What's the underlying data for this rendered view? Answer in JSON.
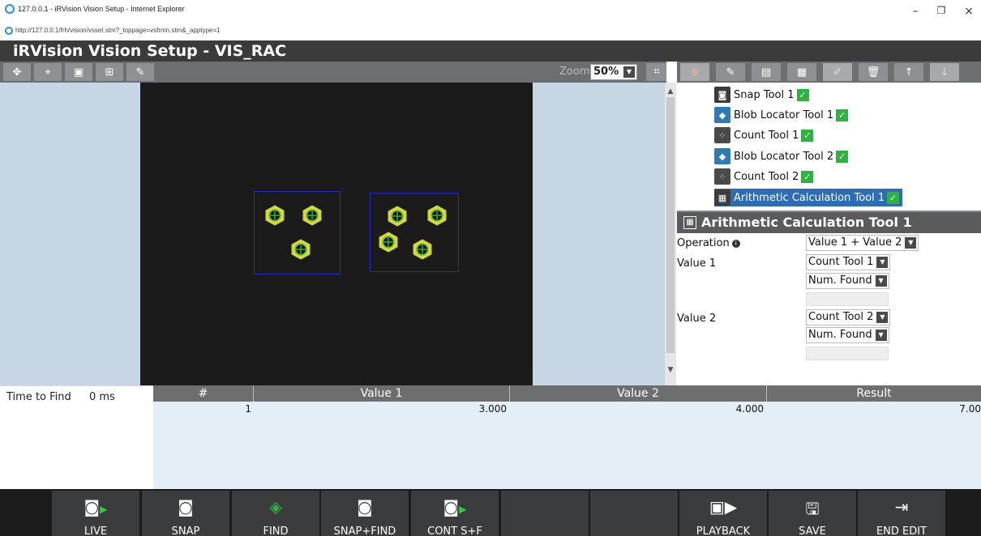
{
  "browser": {
    "window_title": "127.0.0.1 - iRVision Vision Setup - Internet Explorer",
    "url": "http://127.0.0.1/frh/vision/vsset.stm?_toppage=vsfrmn.stm&_apptype=1",
    "minimize": "–",
    "restore": "❐",
    "close": "×"
  },
  "app": {
    "title": "iRVision Vision Setup - VIS_RAC"
  },
  "image_toolbar": {
    "zoom_label": "Zoom",
    "zoom_value": "50%"
  },
  "tree": {
    "items": [
      {
        "label": "Snap Tool 1",
        "icon": "camera-icon",
        "checked": true
      },
      {
        "label": "Blob Locator Tool 1",
        "icon": "blob-icon",
        "checked": true
      },
      {
        "label": "Count Tool 1",
        "icon": "count-icon",
        "checked": true
      },
      {
        "label": "Blob Locator Tool 2",
        "icon": "blob-icon",
        "checked": true
      },
      {
        "label": "Count Tool 2",
        "icon": "count-icon",
        "checked": true
      },
      {
        "label": "Arithmetic Calculation Tool 1",
        "icon": "calculator-icon",
        "checked": true,
        "selected": true
      }
    ]
  },
  "props": {
    "title": "Arithmetic Calculation Tool 1",
    "operation_label": "Operation",
    "operation_value": "Value 1 + Value 2",
    "value1_label": "Value 1",
    "value1_tool": "Count Tool 1",
    "value1_field": "Num. Found",
    "value2_label": "Value 2",
    "value2_tool": "Count Tool 2",
    "value2_field": "Num. Found"
  },
  "results": {
    "time_label": "Time to Find",
    "time_value": "0 ms",
    "columns": [
      "#",
      "Value 1",
      "Value 2",
      "Result"
    ],
    "rows": [
      {
        "num": "1",
        "value1": "3.000",
        "value2": "4.000",
        "result": "7.00"
      }
    ]
  },
  "bottom_bar": {
    "live": "LIVE",
    "snap": "SNAP",
    "find": "FIND",
    "snap_find": "SNAP+FIND",
    "cont_sf": "CONT S+F",
    "playback": "PLAYBACK",
    "save": "SAVE",
    "end_edit": "END EDIT"
  },
  "colors": {
    "header_bg": "#3b3b3b",
    "toolbar_bg": "#6d6e70",
    "selected_bg": "#2d6db5",
    "check_green": "#2eb240",
    "image_bg": "#c6d6e4"
  }
}
